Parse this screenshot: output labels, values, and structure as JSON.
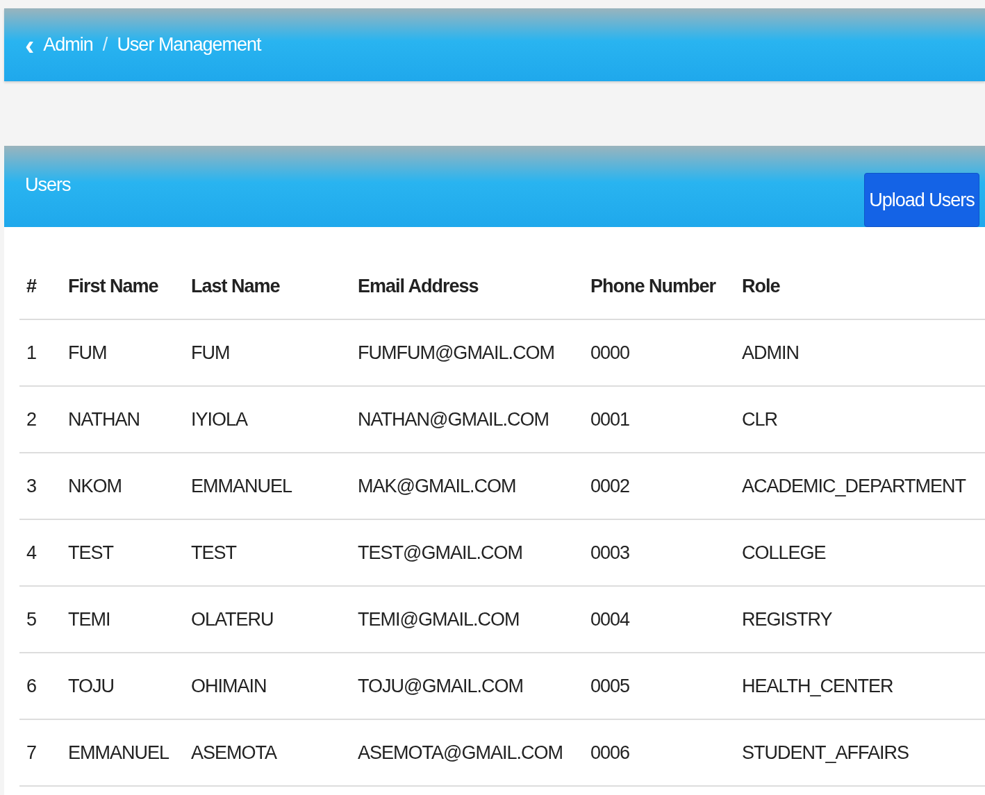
{
  "breadcrumb": {
    "back": "‹",
    "items": [
      "Admin",
      "User Management"
    ],
    "separator": "/"
  },
  "card": {
    "title": "Users",
    "button": "Upload Users"
  },
  "table": {
    "columns": [
      "#",
      "First Name",
      "Last Name",
      "Email Address",
      "Phone Number",
      "Role"
    ],
    "rows": [
      [
        "1",
        "FUM",
        "FUM",
        "FUMFUM@GMAIL.COM",
        "0000",
        "ADMIN"
      ],
      [
        "2",
        "NATHAN",
        "IYIOLA",
        "NATHAN@GMAIL.COM",
        "0001",
        "CLR"
      ],
      [
        "3",
        "NKOM",
        "EMMANUEL",
        "MAK@GMAIL.COM",
        "0002",
        "ACADEMIC_DEPARTMENT"
      ],
      [
        "4",
        "TEST",
        "TEST",
        "TEST@GMAIL.COM",
        "0003",
        "COLLEGE"
      ],
      [
        "5",
        "TEMI",
        "OLATERU",
        "TEMI@GMAIL.COM",
        "0004",
        "REGISTRY"
      ],
      [
        "6",
        "TOJU",
        "OHIMAIN",
        "TOJU@GMAIL.COM",
        "0005",
        "HEALTH_CENTER"
      ],
      [
        "7",
        "EMMANUEL",
        "ASEMOTA",
        "ASEMOTA@GMAIL.COM",
        "0006",
        "STUDENT_AFFAIRS"
      ]
    ]
  }
}
